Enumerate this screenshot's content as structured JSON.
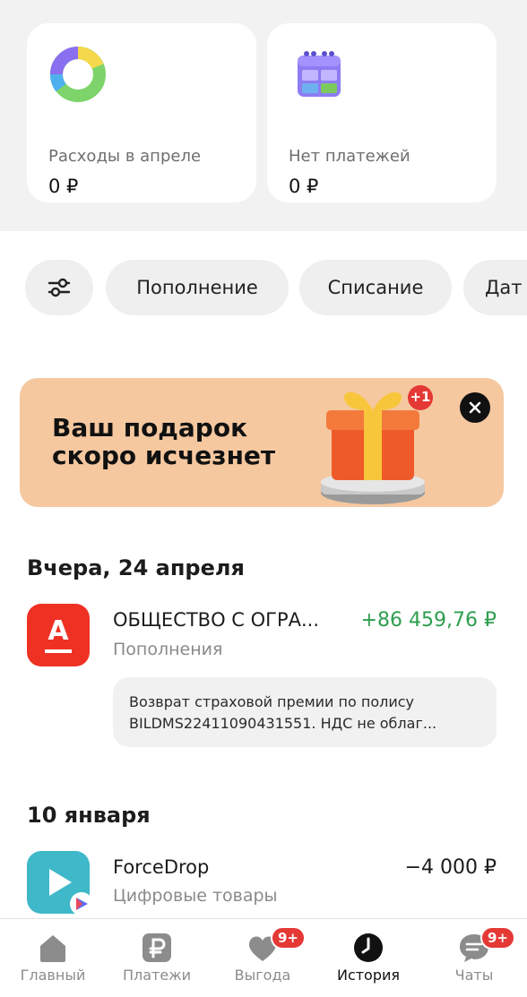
{
  "summary_cards": [
    {
      "label": "Расходы в апреле",
      "value": "0 ₽",
      "icon": "donut-chart-icon"
    },
    {
      "label": "Нет платежей",
      "value": "0 ₽",
      "icon": "calendar-icon"
    }
  ],
  "filters": {
    "settings_icon": "sliders-icon",
    "chips": [
      "Пополнение",
      "Списание",
      "Дат"
    ]
  },
  "banner": {
    "line1": "Ваш подарок",
    "line2": "скоро исчезнет",
    "gift_badge": "+1"
  },
  "sections": [
    {
      "title": "Вчера, 24 апреля",
      "transactions": [
        {
          "icon": "alfa-bank-icon",
          "icon_letter": "А",
          "name": "ОБЩЕСТВО С ОГРА...",
          "category": "Пополнения",
          "amount": "+86 459,76 ₽",
          "note_line1": "Возврат страховой премии по полису",
          "note_line2": "BILDMS22411090431551. НДС не облаг..."
        }
      ]
    },
    {
      "title": "10 января",
      "transactions": [
        {
          "icon": "forcedrop-play-icon",
          "name": "ForceDrop",
          "category": "Цифровые товары",
          "amount": "−4 000 ₽"
        }
      ]
    }
  ],
  "bottom_nav": [
    {
      "label": "Главный",
      "icon": "home-icon",
      "active": false
    },
    {
      "label": "Платежи",
      "icon": "ruble-icon",
      "active": false
    },
    {
      "label": "Выгода",
      "icon": "heart-icon",
      "active": false,
      "badge": "9+"
    },
    {
      "label": "История",
      "icon": "clock-icon",
      "active": true
    },
    {
      "label": "Чаты",
      "icon": "chat-icon",
      "active": false,
      "badge": "9+"
    }
  ],
  "colors": {
    "income": "#2e9e4f",
    "alfa_red": "#ef3124",
    "forcedrop_teal": "#3fb8c9",
    "banner_bg": "#f5c8a0",
    "badge_red": "#e53935"
  }
}
